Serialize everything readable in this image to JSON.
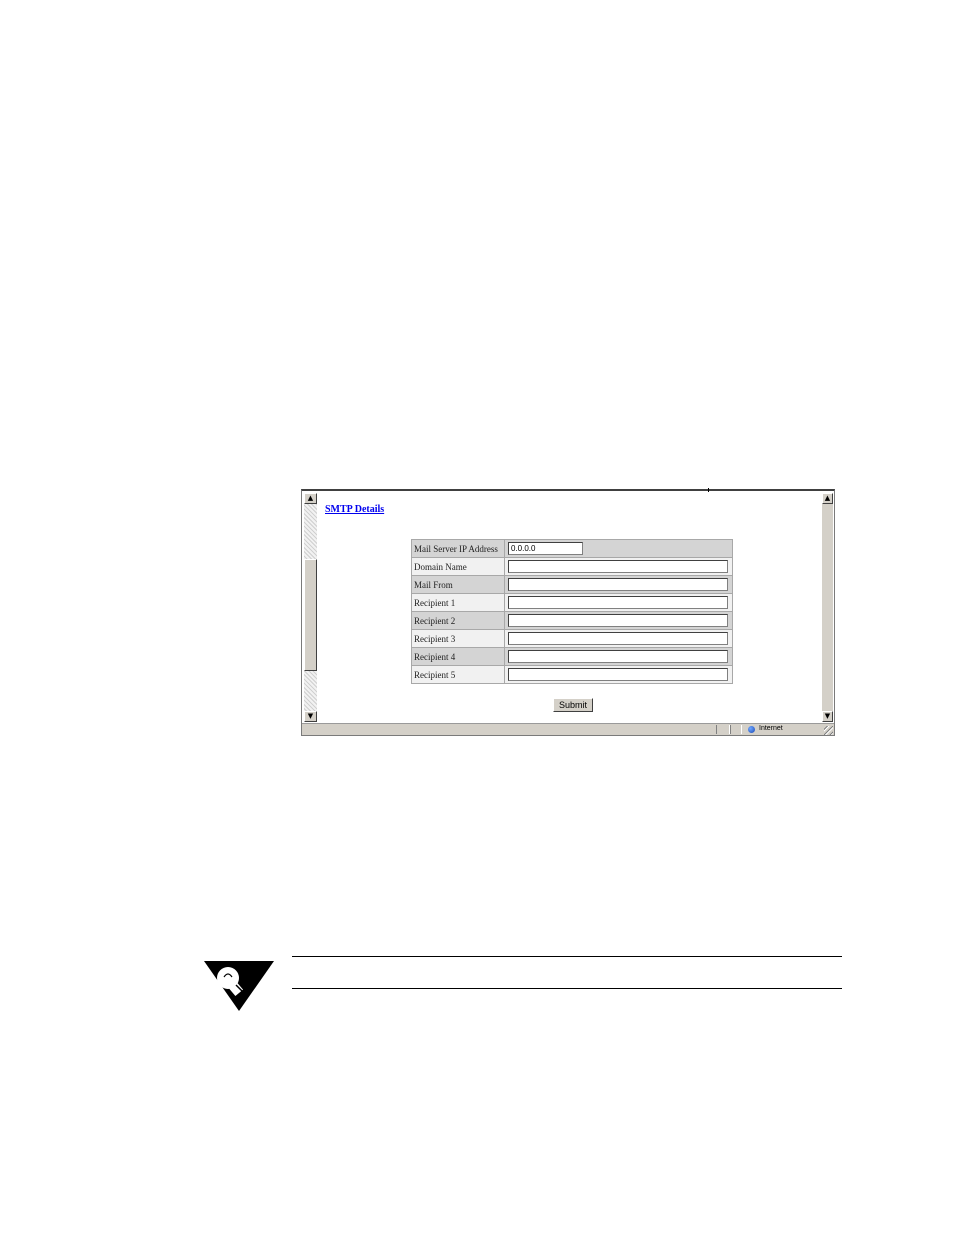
{
  "page": {
    "title": "SMTP Details",
    "submit_label": "Submit"
  },
  "form": {
    "rows": [
      {
        "label": "Mail Server IP Address",
        "value": "0.0.0.0"
      },
      {
        "label": "Domain Name",
        "value": ""
      },
      {
        "label": "Mail From",
        "value": ""
      },
      {
        "label": "Recipient 1",
        "value": ""
      },
      {
        "label": "Recipient 2",
        "value": ""
      },
      {
        "label": "Recipient 3",
        "value": ""
      },
      {
        "label": "Recipient 4",
        "value": ""
      },
      {
        "label": "Recipient 5",
        "value": ""
      }
    ]
  },
  "statusbar": {
    "zone": "Internet",
    "zone_icon": "globe-icon"
  },
  "scrollbar": {
    "up_glyph": "▲",
    "down_glyph": "▼"
  },
  "note": {
    "icon": "lightbulb-icon"
  }
}
